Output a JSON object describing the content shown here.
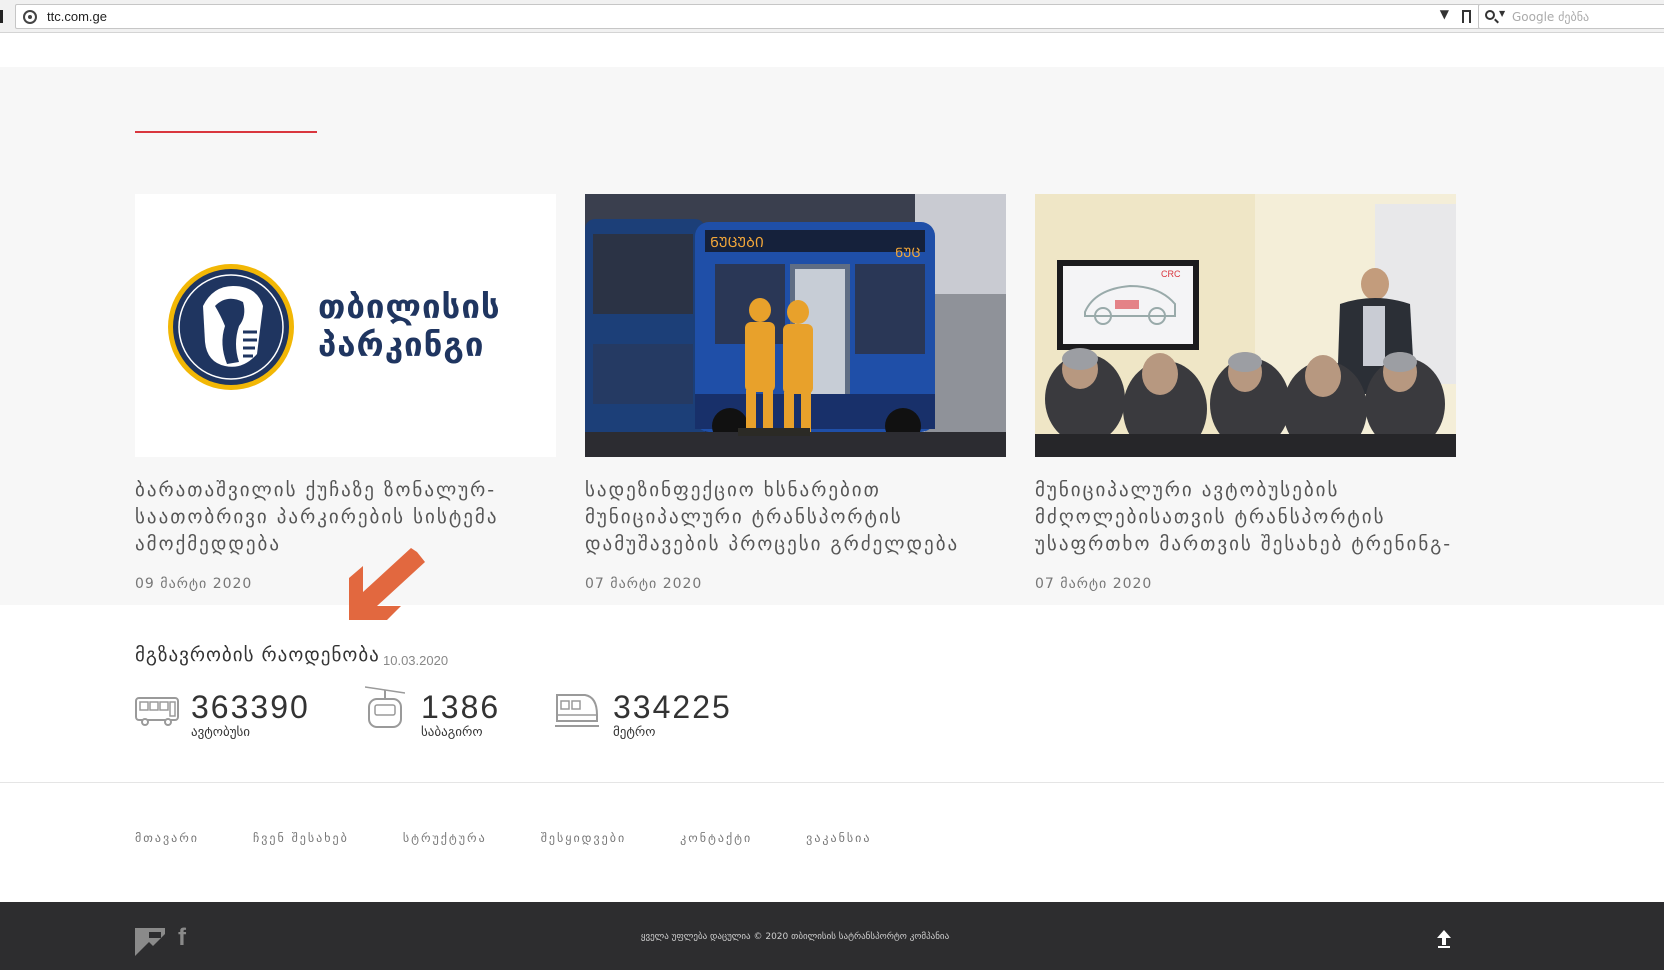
{
  "browser": {
    "url": "ttc.com.ge",
    "search_placeholder": "Google ძებნა"
  },
  "news": {
    "cards": [
      {
        "title": "ბარათაშვილის ქუჩაზე ზონალურ-საათობრივი პარკირების სისტემა ამოქმედდება",
        "date": "09 მარტი 2020",
        "logo_line1": "თბილისის",
        "logo_line2": "პარკინგი"
      },
      {
        "title": "სადეზინფექციო ხსნარებით მუნიციპალური ტრანსპორტის დამუშავების პროცესი გრძელდება",
        "date": "07 მარტი 2020"
      },
      {
        "title": "მუნიციპალური ავტობუსების მძღოლებისათვის ტრანსპორტის უსაფრთხო მართვის შესახებ ტრენინგ-",
        "date": "07 მარტი 2020"
      }
    ]
  },
  "stats": {
    "title": "მგზავრობის რაოდენობა",
    "date": "10.03.2020",
    "items": [
      {
        "value": "363390",
        "label": "ავტობუსი",
        "icon": "bus-icon"
      },
      {
        "value": "1386",
        "label": "საბაგირო",
        "icon": "cable-car-icon"
      },
      {
        "value": "334225",
        "label": "მეტრო",
        "icon": "metro-icon"
      }
    ]
  },
  "footer_nav": [
    "მთავარი",
    "ჩვენ შესახებ",
    "სტრუქტურა",
    "შესყიდვები",
    "კონტაქტი",
    "ვაკანსია"
  ],
  "bottom": {
    "copyright": "ყველა უფლება დაცულია © 2020 თბილისის სატრანსპორტო კომპანია"
  },
  "colors": {
    "accent": "#d9363e",
    "arrow": "#e2683f",
    "footer_bg": "#2d2d2f"
  }
}
